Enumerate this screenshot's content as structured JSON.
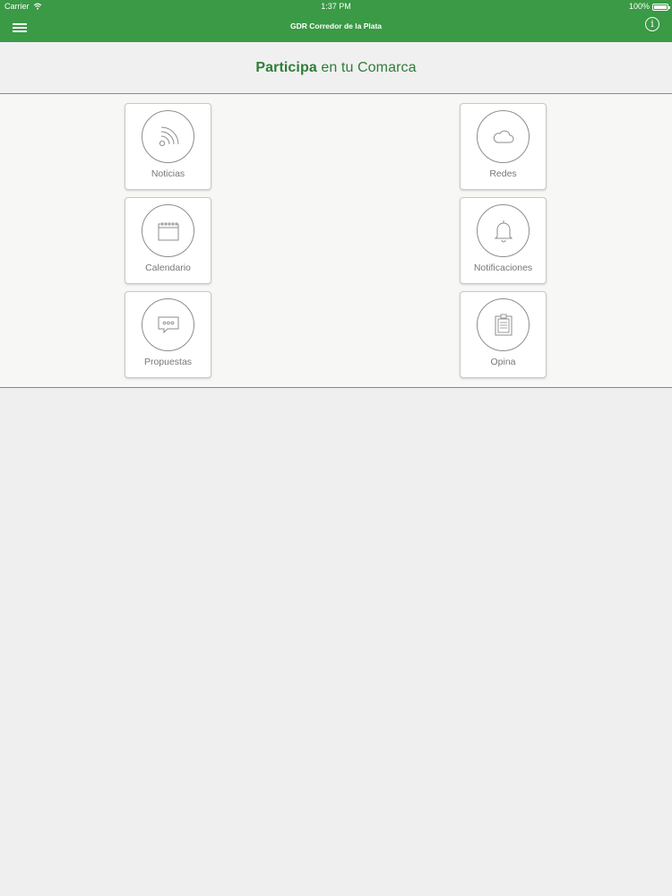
{
  "status_bar": {
    "carrier": "Carrier",
    "time": "1:37 PM",
    "battery": "100%"
  },
  "nav": {
    "title": "GDR Corredor de la Plata",
    "info_glyph": "i",
    "menu_icon": "hamburger-menu-icon",
    "info_icon": "info-circle-icon"
  },
  "header": {
    "title_bold": "Participa",
    "title_rest": "en tu Comarca"
  },
  "tiles": [
    {
      "label": "Noticias",
      "icon": "rss-icon"
    },
    {
      "label": "Redes",
      "icon": "cloud-icon"
    },
    {
      "label": "Calendario",
      "icon": "calendar-icon"
    },
    {
      "label": "Notificaciones",
      "icon": "bell-icon"
    },
    {
      "label": "Propuestas",
      "icon": "chat-bubble-icon"
    },
    {
      "label": "Opina",
      "icon": "clipboard-icon"
    }
  ],
  "colors": {
    "brand_green": "#3a9a45",
    "title_green": "#2f7d38",
    "icon_gray": "#8d8d8d"
  }
}
